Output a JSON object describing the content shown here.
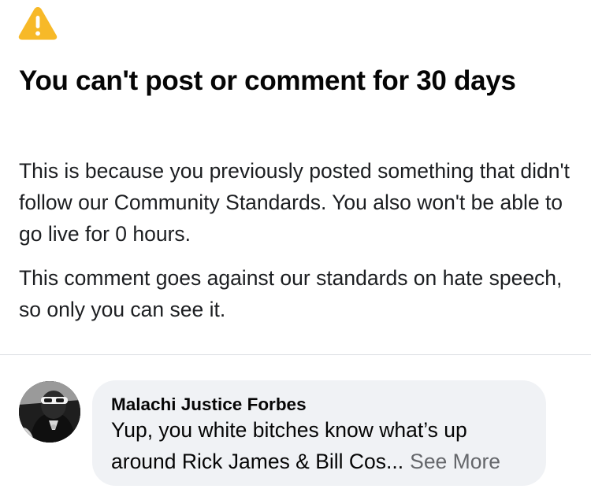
{
  "icons": {
    "warning": "warning-triangle-icon",
    "warning_color": "#F7B928"
  },
  "notice": {
    "title": "You can't post or comment for 30 days",
    "paragraph_1": "This is because you previously posted something that didn't follow our Community Standards. You also won't be able to go live for 0 hours.",
    "paragraph_2": "This comment goes against our standards on hate speech, so only you can see it."
  },
  "comment": {
    "author": "Malachi Justice Forbes",
    "text_line_1": "Yup, you white bitches know what’s up",
    "text_line_2": "around Rick James & Bill Cos...",
    "see_more_label": "See More"
  }
}
